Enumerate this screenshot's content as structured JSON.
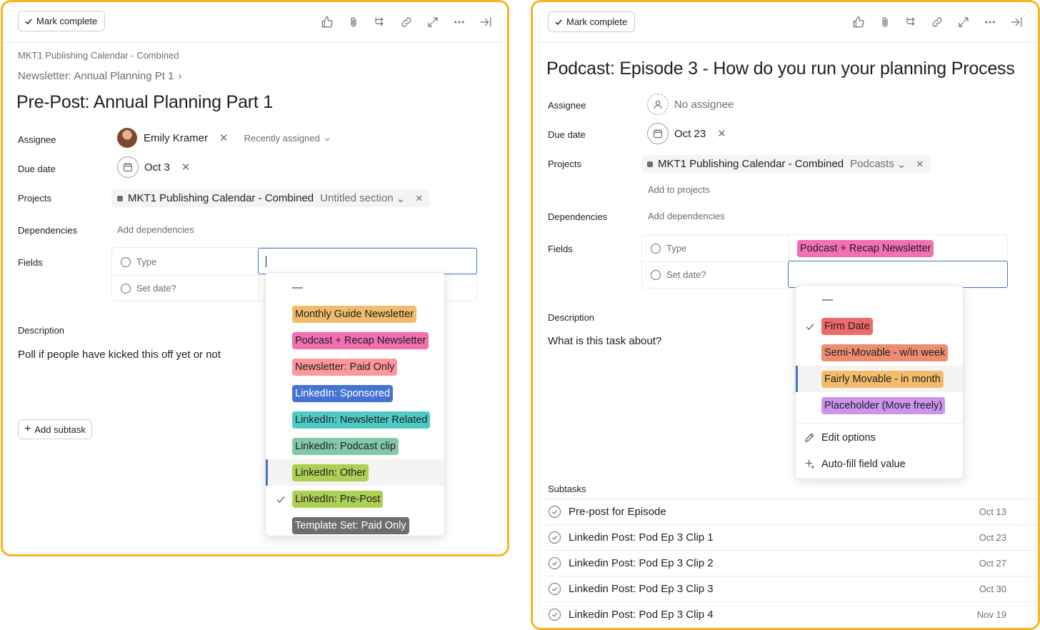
{
  "left": {
    "toolbar": {
      "mark_complete": "Mark complete"
    },
    "breadcrumb": "MKT1 Publishing Calendar - Combined",
    "parent_task": "Newsletter: Annual Planning Pt 1",
    "title": "Pre-Post: Annual Planning Part 1",
    "labels": {
      "assignee": "Assignee",
      "due_date": "Due date",
      "projects": "Projects",
      "dependencies": "Dependencies",
      "fields": "Fields",
      "description": "Description"
    },
    "assignee": {
      "name": "Emily Kramer",
      "recent": "Recently assigned"
    },
    "due_date": "Oct 3",
    "project": {
      "name": "MKT1 Publishing Calendar - Combined",
      "section": "Untitled section"
    },
    "add_dependencies": "Add dependencies",
    "fields": [
      {
        "name": "Type"
      },
      {
        "name": "Set date?"
      }
    ],
    "dropdown": {
      "empty": "—",
      "options": [
        {
          "label": "Monthly Guide Newsletter",
          "bg": "#f1bd6c",
          "fg": "#1e1f21"
        },
        {
          "label": "Podcast + Recap Newsletter",
          "bg": "#f26fb2",
          "fg": "#1e1f21"
        },
        {
          "label": "Newsletter: Paid Only",
          "bg": "#fc979a",
          "fg": "#1e1f21"
        },
        {
          "label": "LinkedIn: Sponsored",
          "bg": "#4573d2",
          "fg": "#ffffff"
        },
        {
          "label": "LinkedIn: Newsletter Related",
          "bg": "#4ecbc4",
          "fg": "#1e1f21"
        },
        {
          "label": "LinkedIn: Podcast clip",
          "bg": "#83c9a9",
          "fg": "#1e1f21"
        },
        {
          "label": "LinkedIn: Other",
          "bg": "#aecf55",
          "fg": "#1e1f21"
        },
        {
          "label": "LinkedIn: Pre-Post",
          "bg": "#aecf55",
          "fg": "#1e1f21"
        },
        {
          "label": "Template Set: Paid Only",
          "bg": "#6d6e6f",
          "fg": "#ffffff"
        }
      ],
      "selected_index": 7,
      "highlighted_index": 6
    },
    "description": "Poll if people have kicked this off yet or not",
    "add_subtask": "Add subtask"
  },
  "right": {
    "toolbar": {
      "mark_complete": "Mark complete"
    },
    "title": "Podcast: Episode 3 - How do you run your planning Process",
    "labels": {
      "assignee": "Assignee",
      "due_date": "Due date",
      "projects": "Projects",
      "dependencies": "Dependencies",
      "fields": "Fields",
      "description": "Description",
      "subtasks": "Subtasks"
    },
    "assignee": "No assignee",
    "due_date": "Oct 23",
    "project": {
      "name": "MKT1 Publishing Calendar - Combined",
      "section": "Podcasts"
    },
    "add_to_projects": "Add to projects",
    "add_dependencies": "Add dependencies",
    "fields": [
      {
        "name": "Type",
        "value": "Podcast + Recap Newsletter",
        "bg": "#f26fb2"
      },
      {
        "name": "Set date?"
      }
    ],
    "dropdown": {
      "empty": "—",
      "options": [
        {
          "label": "Firm Date",
          "bg": "#f06a6a"
        },
        {
          "label": "Semi-Movable - w/in week",
          "bg": "#ec8d71"
        },
        {
          "label": "Fairly Movable - in month",
          "bg": "#f1bd6c"
        },
        {
          "label": "Placeholder (Move freely)",
          "bg": "#cd95ea"
        }
      ],
      "selected_index": 0,
      "highlighted_index": 2,
      "actions": {
        "edit": "Edit options",
        "autofill": "Auto-fill field value"
      }
    },
    "description_placeholder": "What is this task about?",
    "subtasks": [
      {
        "name": "Pre-post for Episode",
        "date": "Oct 13"
      },
      {
        "name": "Linkedin Post: Pod Ep 3 Clip 1",
        "date": "Oct 23"
      },
      {
        "name": "Linkedin Post: Pod Ep 3 Clip 2",
        "date": "Oct 27"
      },
      {
        "name": "Linkedin Post: Pod Ep 3 Clip 3",
        "date": "Oct 30"
      },
      {
        "name": "Linkedin Post: Pod Ep 3 Clip 4",
        "date": "Nov 19"
      }
    ]
  }
}
